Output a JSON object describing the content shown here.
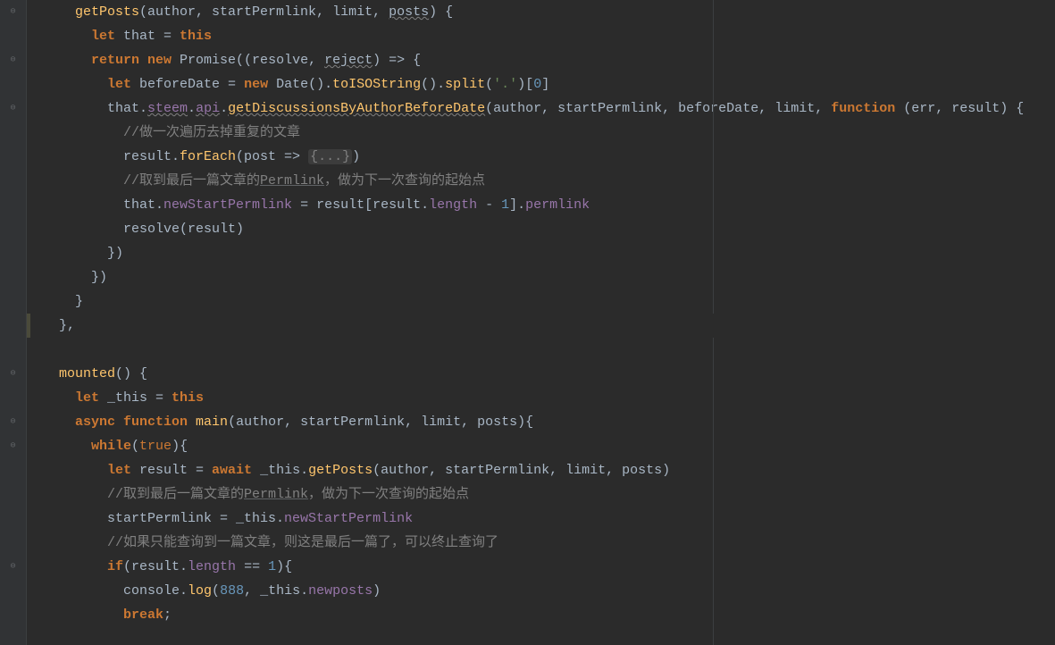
{
  "lines": {
    "l1_indent": "    ",
    "l1_fn": "getPosts",
    "l1_params": "(author, startPermlink, limit, ",
    "l1_posts": "posts",
    "l1_end": ") {",
    "l2": "      ",
    "l2_let": "let ",
    "l2_that": "that = ",
    "l2_this": "this",
    "l3": "      ",
    "l3_return": "return new ",
    "l3_promise": "Promise((resolve, ",
    "l3_reject": "reject",
    "l3_arrow": ") => {",
    "l4": "        ",
    "l4_let": "let ",
    "l4_before": "beforeDate = ",
    "l4_new": "new ",
    "l4_date": "Date().",
    "l4_toiso": "toISOString",
    "l4_split": "().",
    "l4_splitfn": "split",
    "l4_str": "'.'",
    "l4_idx": ")[",
    "l4_zero": "0",
    "l4_close": "]",
    "l5": "        that.",
    "l5_steem": "steem",
    "l5_dot1": ".",
    "l5_api": "api",
    "l5_dot2": ".",
    "l5_getdisc": "getDiscussionsByAuthorBeforeDate",
    "l5_params": "(author, startPermlink, beforeDate, limit, ",
    "l5_function": "function ",
    "l5_errresult": "(err, result) {",
    "l6": "          ",
    "l6_comment": "//做一次遍历去掉重复的文章",
    "l7": "          result.",
    "l7_foreach": "forEach",
    "l7_arrow": "(post => ",
    "l7_fold": "{...}",
    "l7_close": ")",
    "l8": "          ",
    "l8_comment": "//取到最后一篇文章的",
    "l8_permlink": "Permlink",
    "l8_comment2": "，做为下一次查询的起始点",
    "l9": "          that.",
    "l9_newstart": "newStartPermlink",
    "l9_eq": " = result[result.",
    "l9_length": "length",
    "l9_minus": " - ",
    "l9_one": "1",
    "l9_perm": "].",
    "l9_permlink": "permlink",
    "l10": "          resolve(result)",
    "l11": "        })",
    "l12": "      })",
    "l13": "    }",
    "l14": "  },",
    "l15": "",
    "l16": "  ",
    "l16_mounted": "mounted",
    "l16_end": "() {",
    "l17": "    ",
    "l17_let": "let ",
    "l17_this": "_this = ",
    "l17_thiskey": "this",
    "l18": "    ",
    "l18_async": "async function ",
    "l18_main": "main",
    "l18_params": "(author, startPermlink, limit, posts){",
    "l19": "      ",
    "l19_while": "while",
    "l19_true": "(",
    "l19_trueval": "true",
    "l19_close": "){",
    "l20": "        ",
    "l20_let": "let ",
    "l20_result": "result = ",
    "l20_await": "await ",
    "l20_this": "_this.",
    "l20_getposts": "getPosts",
    "l20_params": "(author, startPermlink, limit, posts)",
    "l21": "        ",
    "l21_comment": "//取到最后一篇文章的",
    "l21_permlink": "Permlink",
    "l21_comment2": "，做为下一次查询的起始点",
    "l22": "        startPermlink = _this.",
    "l22_newstart": "newStartPermlink",
    "l23": "        ",
    "l23_comment": "//如果只能查询到一篇文章，则这是最后一篇了，可以终止查询了",
    "l24": "        ",
    "l24_if": "if",
    "l24_open": "(result.",
    "l24_length": "length",
    "l24_eq": " == ",
    "l24_one": "1",
    "l24_close": "){",
    "l25": "          console.",
    "l25_log": "log",
    "l25_open": "(",
    "l25_num": "888",
    "l25_comma": ", _this.",
    "l25_newposts": "newposts",
    "l25_close": ")",
    "l26": "          ",
    "l26_break": "break",
    "l26_semi": ";"
  }
}
